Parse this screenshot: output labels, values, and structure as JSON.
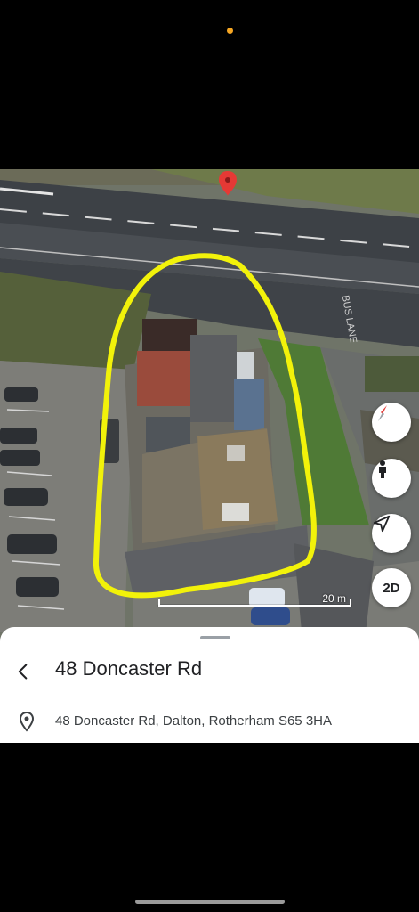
{
  "map": {
    "scale_label": "20 m",
    "mode_toggle_label": "2D",
    "road_marking": "BUS LANE",
    "highlight_color": "#f2f20a",
    "pin_color": "#e53935",
    "icons": [
      "compass-icon",
      "street-view-person-icon",
      "navigation-arrow-icon",
      "location-pin-icon"
    ]
  },
  "place": {
    "title": "48 Doncaster Rd",
    "address": "48 Doncaster Rd, Dalton, Rotherham S65 3HA"
  }
}
